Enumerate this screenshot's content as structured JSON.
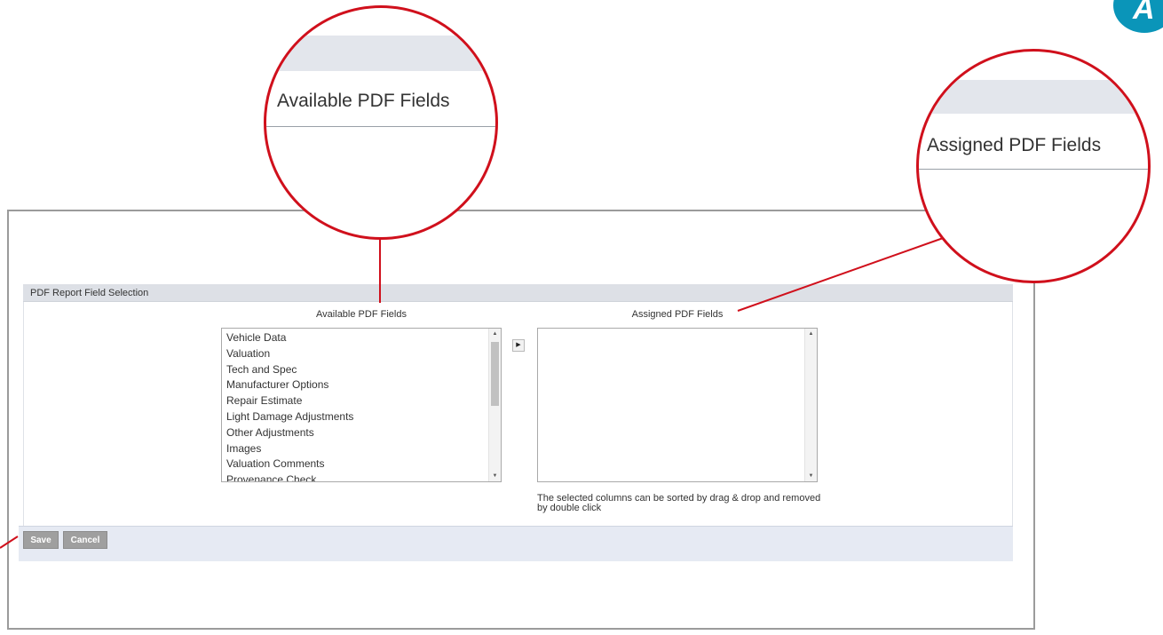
{
  "panel": {
    "title": "PDF Report Field Selection"
  },
  "available": {
    "title": "Available PDF Fields",
    "items": [
      "Vehicle Data",
      "Valuation",
      "Tech and Spec",
      "Manufacturer Options",
      "Repair Estimate",
      "Light Damage Adjustments",
      "Other Adjustments",
      "Images",
      "Valuation Comments",
      "Provenance Check"
    ]
  },
  "assigned": {
    "title": "Assigned PDF Fields",
    "items": [],
    "hint": "The selected columns can be sorted by drag & drop and removed by double click"
  },
  "move_button": {
    "icon": "triangle-right-icon"
  },
  "footer": {
    "save_label": "Save",
    "cancel_label": "Cancel"
  },
  "zoom_callouts": {
    "left_label": "Available PDF Fields",
    "right_label": "Assigned PDF Fields"
  },
  "badge": {
    "letter": "A"
  },
  "colors": {
    "callout_red": "#d0101c",
    "badge_blue": "#0a95b9",
    "header_gray": "#dde0e6",
    "footer_blue": "#e6eaf3",
    "button_gray": "#9f9f9f"
  }
}
